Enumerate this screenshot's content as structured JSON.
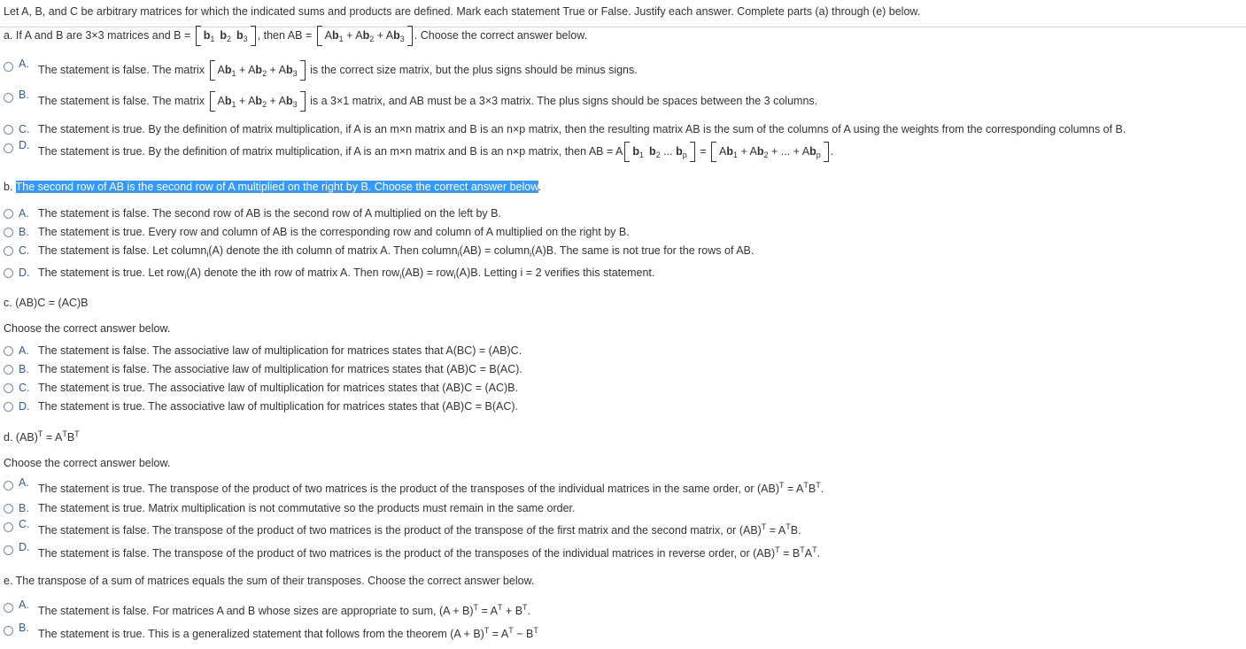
{
  "intro": "Let A, B, and C be arbitrary matrices for which the indicated sums and products are defined. Mark each statement True or False. Justify each answer. Complete parts (a) through (e) below.",
  "parts": {
    "a": {
      "prompt": [
        {
          "t": "a. If A and B are 3×3 matrices and B = "
        },
        {
          "mat": [
            {
              "b": "b"
            },
            {
              "sub": "1"
            },
            {
              "sp": 1
            },
            {
              "b": "b"
            },
            {
              "sub": "2"
            },
            {
              "sp": 1
            },
            {
              "b": "b"
            },
            {
              "sub": "3"
            }
          ]
        },
        {
          "t": ", then AB = "
        },
        {
          "mat": [
            {
              "t": "A"
            },
            {
              "b": "b"
            },
            {
              "sub": "1"
            },
            {
              "t": " + A"
            },
            {
              "b": "b"
            },
            {
              "sub": "2"
            },
            {
              "t": " + A"
            },
            {
              "b": "b"
            },
            {
              "sub": "3"
            }
          ]
        },
        {
          "t": ". Choose the correct answer below."
        }
      ],
      "options": [
        {
          "letter": "A.",
          "text": [
            {
              "t": "The statement is false. The matrix "
            },
            {
              "mat": [
                {
                  "t": "A"
                },
                {
                  "b": "b"
                },
                {
                  "sub": "1"
                },
                {
                  "t": " + A"
                },
                {
                  "b": "b"
                },
                {
                  "sub": "2"
                },
                {
                  "t": " + A"
                },
                {
                  "b": "b"
                },
                {
                  "sub": "3"
                }
              ]
            },
            {
              "t": " is the correct size matrix, but the plus signs should be minus signs."
            }
          ]
        },
        {
          "letter": "B.",
          "text": [
            {
              "t": "The statement is false. The matrix "
            },
            {
              "mat": [
                {
                  "t": "A"
                },
                {
                  "b": "b"
                },
                {
                  "sub": "1"
                },
                {
                  "t": " + A"
                },
                {
                  "b": "b"
                },
                {
                  "sub": "2"
                },
                {
                  "t": " + A"
                },
                {
                  "b": "b"
                },
                {
                  "sub": "3"
                }
              ]
            },
            {
              "t": " is a 3×1 matrix, and AB must be a 3×3 matrix. The plus signs should be spaces between the 3 columns."
            }
          ]
        },
        {
          "letter": "C.",
          "text": [
            {
              "t": "The statement is true. By the definition of matrix multiplication, if A is an m×n matrix and B is an n×p matrix, then the resulting matrix AB is the sum of the columns of A using the weights from the corresponding columns of B."
            }
          ]
        },
        {
          "letter": "D.",
          "text": [
            {
              "t": "The statement is true. By the definition of matrix multiplication, if A is an m×n matrix and B is an n×p matrix, then AB = A"
            },
            {
              "mat": [
                {
                  "b": "b"
                },
                {
                  "sub": "1"
                },
                {
                  "sp": 1
                },
                {
                  "b": "b"
                },
                {
                  "sub": "2"
                },
                {
                  "t": " ... "
                },
                {
                  "b": "b"
                },
                {
                  "sub": "p"
                }
              ]
            },
            {
              "t": " = "
            },
            {
              "mat": [
                {
                  "t": "A"
                },
                {
                  "b": "b"
                },
                {
                  "sub": "1"
                },
                {
                  "t": " + A"
                },
                {
                  "b": "b"
                },
                {
                  "sub": "2"
                },
                {
                  "t": " + ... + A"
                },
                {
                  "b": "b"
                },
                {
                  "sub": "p"
                }
              ]
            },
            {
              "t": "."
            }
          ]
        }
      ]
    },
    "b": {
      "label": "b. ",
      "prompt_highlighted": "The second row of AB is the second row of A multiplied on the right by B. Choose the correct answer below",
      "prompt_tail": ".",
      "options": [
        {
          "letter": "A.",
          "text": [
            {
              "t": "The statement is false. The second row of AB is the second row of A multiplied on the left by B."
            }
          ]
        },
        {
          "letter": "B.",
          "text": [
            {
              "t": "The statement is true. Every row and column of AB is the corresponding row and column of A multiplied on the right by B."
            }
          ]
        },
        {
          "letter": "C.",
          "text": [
            {
              "t": "The statement is false. Let column"
            },
            {
              "sub": "i"
            },
            {
              "t": "(A) denote the ith column of matrix A. Then column"
            },
            {
              "sub": "i"
            },
            {
              "t": "(AB) = column"
            },
            {
              "sub": "i"
            },
            {
              "t": "(A)B. The same is not true for the rows of AB."
            }
          ]
        },
        {
          "letter": "D.",
          "text": [
            {
              "t": "The statement is true. Let row"
            },
            {
              "sub": "i"
            },
            {
              "t": "(A) denote the ith row of matrix A. Then row"
            },
            {
              "sub": "i"
            },
            {
              "t": "(AB) = row"
            },
            {
              "sub": "i"
            },
            {
              "t": "(A)B. Letting i = 2 verifies this statement."
            }
          ]
        }
      ]
    },
    "c": {
      "prompt": "c. (AB)C = (AC)B",
      "choose": "Choose the correct answer below.",
      "options": [
        {
          "letter": "A.",
          "text": [
            {
              "t": "The statement is false. The associative law of multiplication for matrices states that A(BC) = (AB)C."
            }
          ]
        },
        {
          "letter": "B.",
          "text": [
            {
              "t": "The statement is false. The associative law of multiplication for matrices states that (AB)C = B(AC)."
            }
          ]
        },
        {
          "letter": "C.",
          "text": [
            {
              "t": "The statement is true. The associative law of multiplication for matrices states that (AB)C = (AC)B."
            }
          ]
        },
        {
          "letter": "D.",
          "text": [
            {
              "t": "The statement is true. The associative law of multiplication for matrices states that (AB)C = B(AC)."
            }
          ]
        }
      ]
    },
    "d": {
      "prompt": [
        {
          "t": "d. (AB)"
        },
        {
          "sup": "T"
        },
        {
          "t": " = A"
        },
        {
          "sup": "T"
        },
        {
          "t": "B"
        },
        {
          "sup": "T"
        }
      ],
      "choose": "Choose the correct answer below.",
      "options": [
        {
          "letter": "A.",
          "text": [
            {
              "t": "The statement is true. The transpose of the product of two matrices is the product of the transposes of the individual matrices in the same order, or (AB)"
            },
            {
              "sup": "T"
            },
            {
              "t": " = A"
            },
            {
              "sup": "T"
            },
            {
              "t": "B"
            },
            {
              "sup": "T"
            },
            {
              "t": "."
            }
          ]
        },
        {
          "letter": "B.",
          "text": [
            {
              "t": "The statement is true. Matrix multiplication is not commutative so the products must remain in the same order."
            }
          ]
        },
        {
          "letter": "C.",
          "text": [
            {
              "t": "The statement is false. The transpose of the product of two matrices is the product of the transpose of the first matrix and the second matrix, or (AB)"
            },
            {
              "sup": "T"
            },
            {
              "t": " = A"
            },
            {
              "sup": "T"
            },
            {
              "t": "B."
            }
          ]
        },
        {
          "letter": "D.",
          "text": [
            {
              "t": "The statement is false. The transpose of the product of two matrices is the product of the transposes of the individual matrices in reverse order, or (AB)"
            },
            {
              "sup": "T"
            },
            {
              "t": " = B"
            },
            {
              "sup": "T"
            },
            {
              "t": "A"
            },
            {
              "sup": "T"
            },
            {
              "t": "."
            }
          ]
        }
      ]
    },
    "e": {
      "prompt": "e. The transpose of a sum of matrices equals the sum of their transposes. Choose the correct answer below.",
      "options": [
        {
          "letter": "A.",
          "text": [
            {
              "t": "The statement is false. For matrices A and B whose sizes are appropriate to sum, (A + B)"
            },
            {
              "sup": "T"
            },
            {
              "t": " = A"
            },
            {
              "sup": "T"
            },
            {
              "t": " + B"
            },
            {
              "sup": "T"
            },
            {
              "t": "."
            }
          ]
        },
        {
          "letter": "B.",
          "text": [
            {
              "t": "The statement is true. This is a generalized statement that follows from the theorem (A + B)"
            },
            {
              "sup": "T"
            },
            {
              "t": " = A"
            },
            {
              "sup": "T"
            },
            {
              "t": " − B"
            },
            {
              "sup": "T"
            }
          ]
        }
      ]
    }
  },
  "colors": {
    "option_letter": "#3a5a9c",
    "highlight": "#3399ff",
    "text": "#333333"
  }
}
